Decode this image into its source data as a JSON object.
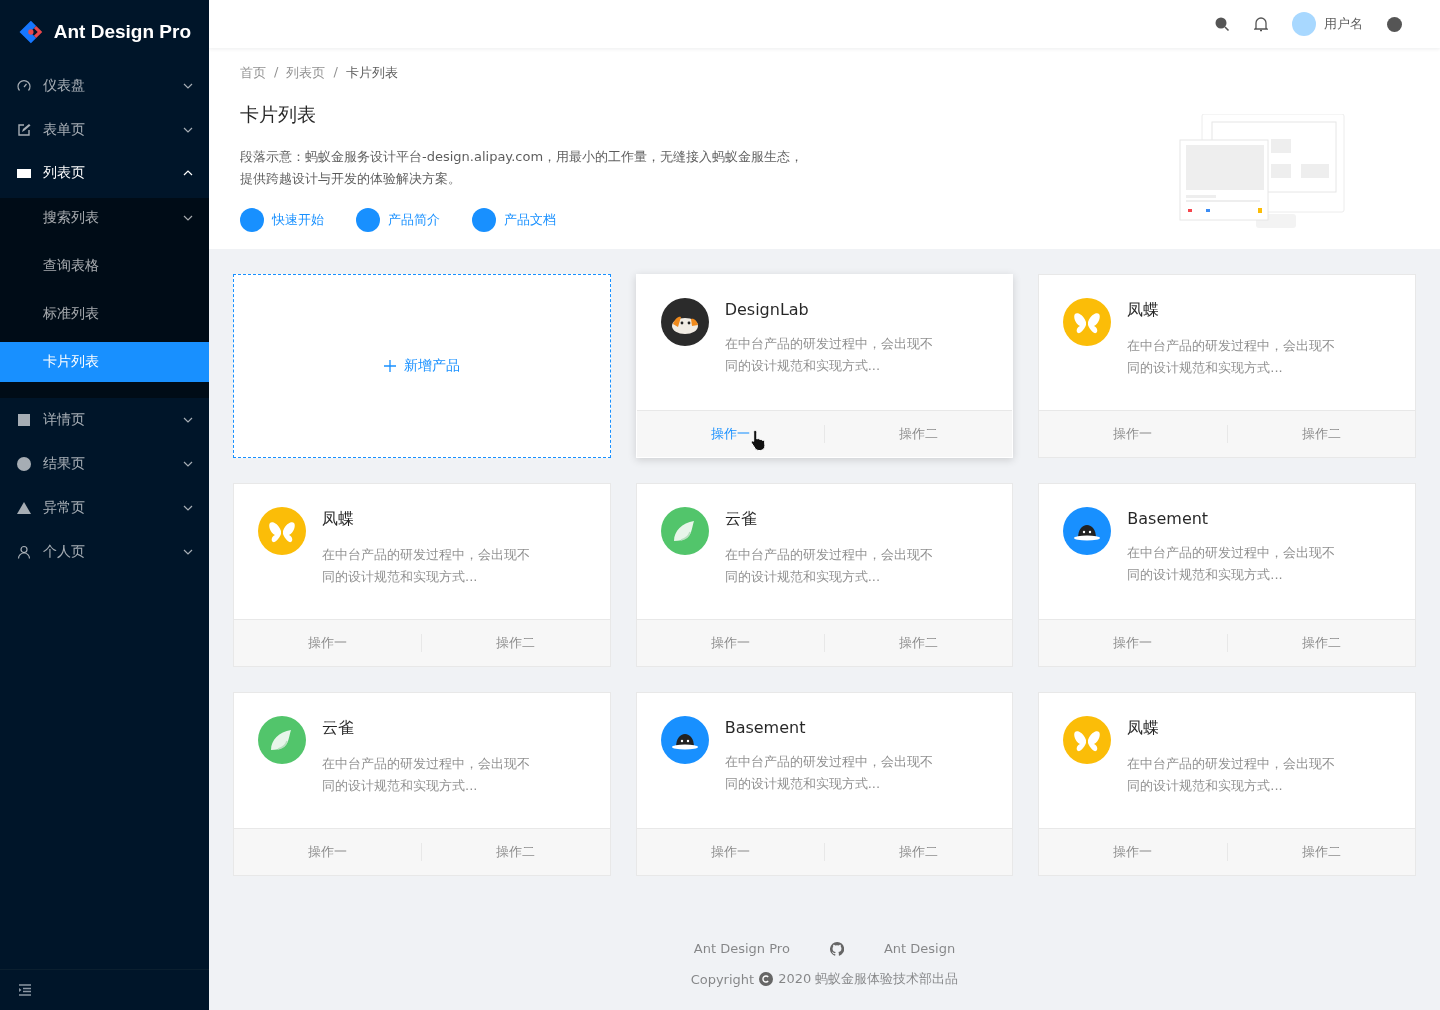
{
  "sidebar": {
    "logo_text": "Ant Design Pro",
    "items": [
      {
        "label": "仪表盘",
        "kind": "dashboard",
        "expanded": false
      },
      {
        "label": "表单页",
        "kind": "form",
        "expanded": false
      },
      {
        "label": "列表页",
        "kind": "list",
        "expanded": true,
        "children": [
          {
            "label": "搜索列表",
            "kind": "submenu",
            "selected": false
          },
          {
            "label": "查询表格",
            "kind": "link",
            "selected": false
          },
          {
            "label": "标准列表",
            "kind": "link",
            "selected": false
          },
          {
            "label": "卡片列表",
            "kind": "link",
            "selected": true
          }
        ]
      },
      {
        "label": "详情页",
        "kind": "profile",
        "expanded": false
      },
      {
        "label": "结果页",
        "kind": "result",
        "expanded": false
      },
      {
        "label": "异常页",
        "kind": "exception",
        "expanded": false
      },
      {
        "label": "个人页",
        "kind": "account",
        "expanded": false
      }
    ]
  },
  "header": {
    "username": "用户名"
  },
  "page_header": {
    "breadcrumb": [
      {
        "kind": "link",
        "text": "首页"
      },
      {
        "kind": "separator",
        "text": "/"
      },
      {
        "kind": "link",
        "text": "列表页"
      },
      {
        "kind": "separator",
        "text": "/"
      },
      {
        "kind": "current",
        "text": "卡片列表"
      }
    ],
    "title": "卡片列表",
    "description": [
      "段落示意：蚂蚁金服务设计平台-design.alipay.com，用最小的工作量，无缝接入蚂蚁金服生态，",
      "提供跨越设计与开发的体验解决方案。"
    ],
    "links": [
      "快速开始",
      "产品简介",
      "产品文档"
    ]
  },
  "add_card": {
    "label": "新增产品"
  },
  "cards": [
    {
      "kind": "product",
      "title": "DesignLab",
      "avatar": {
        "kind": "cat",
        "color": "#2b2b2b"
      },
      "hovered": true,
      "description": "在中台产品的研发过程中，会出现不同的设计规范和实现方式...",
      "actions": [
        {
          "label": "操作一",
          "hovered": true
        },
        {
          "label": "操作二",
          "hovered": false
        }
      ]
    },
    {
      "kind": "product",
      "title": "凤蝶",
      "avatar": {
        "kind": "butterfly",
        "color": "#fbbd08"
      },
      "hovered": false,
      "description": "在中台产品的研发过程中，会出现不同的设计规范和实现方式...",
      "actions": [
        {
          "label": "操作一",
          "hovered": false
        },
        {
          "label": "操作二",
          "hovered": false
        }
      ]
    },
    {
      "kind": "product",
      "title": "凤蝶",
      "avatar": {
        "kind": "butterfly",
        "color": "#fbbd08"
      },
      "hovered": false,
      "description": "在中台产品的研发过程中，会出现不同的设计规范和实现方式...",
      "actions": [
        {
          "label": "操作一",
          "hovered": false
        },
        {
          "label": "操作二",
          "hovered": false
        }
      ]
    },
    {
      "kind": "product",
      "title": "云雀",
      "avatar": {
        "kind": "bird",
        "color": "#52c56b"
      },
      "hovered": false,
      "description": "在中台产品的研发过程中，会出现不同的设计规范和实现方式...",
      "actions": [
        {
          "label": "操作一",
          "hovered": false
        },
        {
          "label": "操作二",
          "hovered": false
        }
      ]
    },
    {
      "kind": "product",
      "title": "Basement",
      "avatar": {
        "kind": "ghost",
        "color": "#1890ff"
      },
      "hovered": false,
      "description": "在中台产品的研发过程中，会出现不同的设计规范和实现方式...",
      "actions": [
        {
          "label": "操作一",
          "hovered": false
        },
        {
          "label": "操作二",
          "hovered": false
        }
      ]
    },
    {
      "kind": "product",
      "title": "云雀",
      "avatar": {
        "kind": "bird",
        "color": "#52c56b"
      },
      "hovered": false,
      "description": "在中台产品的研发过程中，会出现不同的设计规范和实现方式...",
      "actions": [
        {
          "label": "操作一",
          "hovered": false
        },
        {
          "label": "操作二",
          "hovered": false
        }
      ]
    },
    {
      "kind": "product",
      "title": "Basement",
      "avatar": {
        "kind": "ghost",
        "color": "#1890ff"
      },
      "hovered": false,
      "description": "在中台产品的研发过程中，会出现不同的设计规范和实现方式...",
      "actions": [
        {
          "label": "操作一",
          "hovered": false
        },
        {
          "label": "操作二",
          "hovered": false
        }
      ]
    },
    {
      "kind": "product",
      "title": "凤蝶",
      "avatar": {
        "kind": "butterfly",
        "color": "#fbbd08"
      },
      "hovered": false,
      "description": "在中台产品的研发过程中，会出现不同的设计规范和实现方式...",
      "actions": [
        {
          "label": "操作一",
          "hovered": false
        },
        {
          "label": "操作二",
          "hovered": false
        }
      ]
    }
  ],
  "footer": {
    "links": [
      "Ant Design Pro",
      "Ant Design"
    ],
    "copyright_prefix": "Copyright",
    "copyright_text": "2020 蚂蚁金服体验技术部出品"
  }
}
